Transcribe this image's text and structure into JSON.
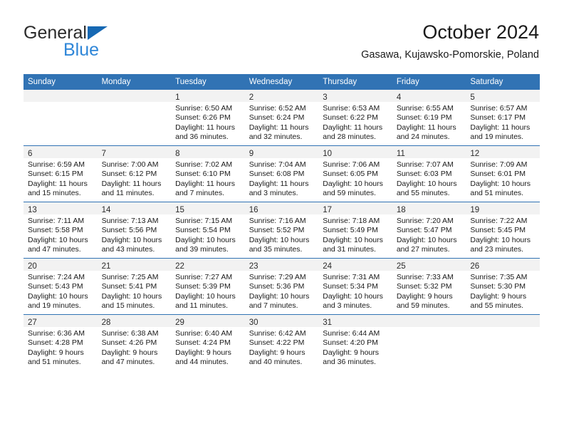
{
  "brand": {
    "name_top": "General",
    "name_bottom": "Blue",
    "accent_color": "#1668b3",
    "accent_color_light": "#2e86d8"
  },
  "header": {
    "title": "October 2024",
    "subtitle": "Gasawa, Kujawsko-Pomorskie, Poland"
  },
  "calendar": {
    "header_background": "#3173b4",
    "daynum_band_background": "#f2f2f2",
    "weekdays": [
      "Sunday",
      "Monday",
      "Tuesday",
      "Wednesday",
      "Thursday",
      "Friday",
      "Saturday"
    ],
    "labels": {
      "sunrise": "Sunrise:",
      "sunset": "Sunset:",
      "daylight": "Daylight:"
    },
    "weeks": [
      [
        {
          "day": "",
          "empty": true
        },
        {
          "day": "",
          "empty": true
        },
        {
          "day": "1",
          "line1": "Sunrise: 6:50 AM",
          "line2": "Sunset: 6:26 PM",
          "line3": "Daylight: 11 hours",
          "line4": "and 36 minutes."
        },
        {
          "day": "2",
          "line1": "Sunrise: 6:52 AM",
          "line2": "Sunset: 6:24 PM",
          "line3": "Daylight: 11 hours",
          "line4": "and 32 minutes."
        },
        {
          "day": "3",
          "line1": "Sunrise: 6:53 AM",
          "line2": "Sunset: 6:22 PM",
          "line3": "Daylight: 11 hours",
          "line4": "and 28 minutes."
        },
        {
          "day": "4",
          "line1": "Sunrise: 6:55 AM",
          "line2": "Sunset: 6:19 PM",
          "line3": "Daylight: 11 hours",
          "line4": "and 24 minutes."
        },
        {
          "day": "5",
          "line1": "Sunrise: 6:57 AM",
          "line2": "Sunset: 6:17 PM",
          "line3": "Daylight: 11 hours",
          "line4": "and 19 minutes."
        }
      ],
      [
        {
          "day": "6",
          "line1": "Sunrise: 6:59 AM",
          "line2": "Sunset: 6:15 PM",
          "line3": "Daylight: 11 hours",
          "line4": "and 15 minutes."
        },
        {
          "day": "7",
          "line1": "Sunrise: 7:00 AM",
          "line2": "Sunset: 6:12 PM",
          "line3": "Daylight: 11 hours",
          "line4": "and 11 minutes."
        },
        {
          "day": "8",
          "line1": "Sunrise: 7:02 AM",
          "line2": "Sunset: 6:10 PM",
          "line3": "Daylight: 11 hours",
          "line4": "and 7 minutes."
        },
        {
          "day": "9",
          "line1": "Sunrise: 7:04 AM",
          "line2": "Sunset: 6:08 PM",
          "line3": "Daylight: 11 hours",
          "line4": "and 3 minutes."
        },
        {
          "day": "10",
          "line1": "Sunrise: 7:06 AM",
          "line2": "Sunset: 6:05 PM",
          "line3": "Daylight: 10 hours",
          "line4": "and 59 minutes."
        },
        {
          "day": "11",
          "line1": "Sunrise: 7:07 AM",
          "line2": "Sunset: 6:03 PM",
          "line3": "Daylight: 10 hours",
          "line4": "and 55 minutes."
        },
        {
          "day": "12",
          "line1": "Sunrise: 7:09 AM",
          "line2": "Sunset: 6:01 PM",
          "line3": "Daylight: 10 hours",
          "line4": "and 51 minutes."
        }
      ],
      [
        {
          "day": "13",
          "line1": "Sunrise: 7:11 AM",
          "line2": "Sunset: 5:58 PM",
          "line3": "Daylight: 10 hours",
          "line4": "and 47 minutes."
        },
        {
          "day": "14",
          "line1": "Sunrise: 7:13 AM",
          "line2": "Sunset: 5:56 PM",
          "line3": "Daylight: 10 hours",
          "line4": "and 43 minutes."
        },
        {
          "day": "15",
          "line1": "Sunrise: 7:15 AM",
          "line2": "Sunset: 5:54 PM",
          "line3": "Daylight: 10 hours",
          "line4": "and 39 minutes."
        },
        {
          "day": "16",
          "line1": "Sunrise: 7:16 AM",
          "line2": "Sunset: 5:52 PM",
          "line3": "Daylight: 10 hours",
          "line4": "and 35 minutes."
        },
        {
          "day": "17",
          "line1": "Sunrise: 7:18 AM",
          "line2": "Sunset: 5:49 PM",
          "line3": "Daylight: 10 hours",
          "line4": "and 31 minutes."
        },
        {
          "day": "18",
          "line1": "Sunrise: 7:20 AM",
          "line2": "Sunset: 5:47 PM",
          "line3": "Daylight: 10 hours",
          "line4": "and 27 minutes."
        },
        {
          "day": "19",
          "line1": "Sunrise: 7:22 AM",
          "line2": "Sunset: 5:45 PM",
          "line3": "Daylight: 10 hours",
          "line4": "and 23 minutes."
        }
      ],
      [
        {
          "day": "20",
          "line1": "Sunrise: 7:24 AM",
          "line2": "Sunset: 5:43 PM",
          "line3": "Daylight: 10 hours",
          "line4": "and 19 minutes."
        },
        {
          "day": "21",
          "line1": "Sunrise: 7:25 AM",
          "line2": "Sunset: 5:41 PM",
          "line3": "Daylight: 10 hours",
          "line4": "and 15 minutes."
        },
        {
          "day": "22",
          "line1": "Sunrise: 7:27 AM",
          "line2": "Sunset: 5:39 PM",
          "line3": "Daylight: 10 hours",
          "line4": "and 11 minutes."
        },
        {
          "day": "23",
          "line1": "Sunrise: 7:29 AM",
          "line2": "Sunset: 5:36 PM",
          "line3": "Daylight: 10 hours",
          "line4": "and 7 minutes."
        },
        {
          "day": "24",
          "line1": "Sunrise: 7:31 AM",
          "line2": "Sunset: 5:34 PM",
          "line3": "Daylight: 10 hours",
          "line4": "and 3 minutes."
        },
        {
          "day": "25",
          "line1": "Sunrise: 7:33 AM",
          "line2": "Sunset: 5:32 PM",
          "line3": "Daylight: 9 hours",
          "line4": "and 59 minutes."
        },
        {
          "day": "26",
          "line1": "Sunrise: 7:35 AM",
          "line2": "Sunset: 5:30 PM",
          "line3": "Daylight: 9 hours",
          "line4": "and 55 minutes."
        }
      ],
      [
        {
          "day": "27",
          "line1": "Sunrise: 6:36 AM",
          "line2": "Sunset: 4:28 PM",
          "line3": "Daylight: 9 hours",
          "line4": "and 51 minutes."
        },
        {
          "day": "28",
          "line1": "Sunrise: 6:38 AM",
          "line2": "Sunset: 4:26 PM",
          "line3": "Daylight: 9 hours",
          "line4": "and 47 minutes."
        },
        {
          "day": "29",
          "line1": "Sunrise: 6:40 AM",
          "line2": "Sunset: 4:24 PM",
          "line3": "Daylight: 9 hours",
          "line4": "and 44 minutes."
        },
        {
          "day": "30",
          "line1": "Sunrise: 6:42 AM",
          "line2": "Sunset: 4:22 PM",
          "line3": "Daylight: 9 hours",
          "line4": "and 40 minutes."
        },
        {
          "day": "31",
          "line1": "Sunrise: 6:44 AM",
          "line2": "Sunset: 4:20 PM",
          "line3": "Daylight: 9 hours",
          "line4": "and 36 minutes."
        },
        {
          "day": "",
          "empty": true
        },
        {
          "day": "",
          "empty": true
        }
      ]
    ]
  }
}
